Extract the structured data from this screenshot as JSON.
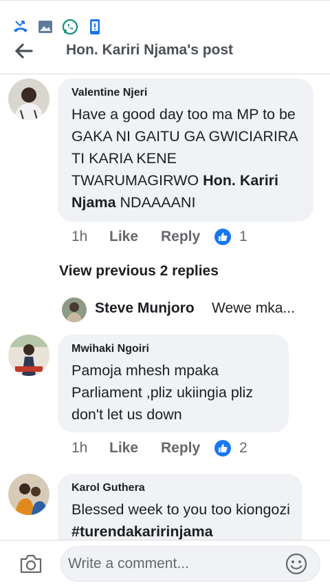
{
  "status_bar": {
    "icons": [
      "missed-call-icon",
      "image-icon",
      "whatsapp-icon",
      "phone-device-icon"
    ]
  },
  "header": {
    "title": "Hon. Kariri Njama's post",
    "back_icon": "arrow-left-icon"
  },
  "comments": [
    {
      "author": "Valentine Njeri",
      "text_plain": "Have a good day too ma MP to be GAKA NI GAITU GA GWICIARIRA TI KARIA KENE TWARUMAGIRWO ",
      "mention": "Hon. Kariri Njama",
      "text_after": " NDAAAANI",
      "time": "1h",
      "like_label": "Like",
      "reply_label": "Reply",
      "reactions": "1"
    },
    {
      "author": "Mwihaki Ngoiri",
      "text": "Pamoja mhesh mpaka Parliament ,pliz ukiingia pliz don't let us down",
      "time": "1h",
      "like_label": "Like",
      "reply_label": "Reply",
      "reactions": "2"
    },
    {
      "author": "Karol Guthera",
      "text_plain": "Blessed week to you too kiongozi ",
      "hashtag": "#turendakaririnjama"
    }
  ],
  "view_previous": "View previous 2 replies",
  "reply_preview": {
    "name": "Steve Munjoro",
    "snippet": "Wewe mka..."
  },
  "composer": {
    "placeholder": "Write a comment...",
    "camera_icon": "camera-icon",
    "emoji_icon": "emoji-icon"
  },
  "colors": {
    "like_blue": "#1877f2",
    "bubble": "#f0f2f5",
    "muted": "#65676b",
    "status_icon_blue": "#1a73e8",
    "whatsapp": "#128c7e"
  }
}
